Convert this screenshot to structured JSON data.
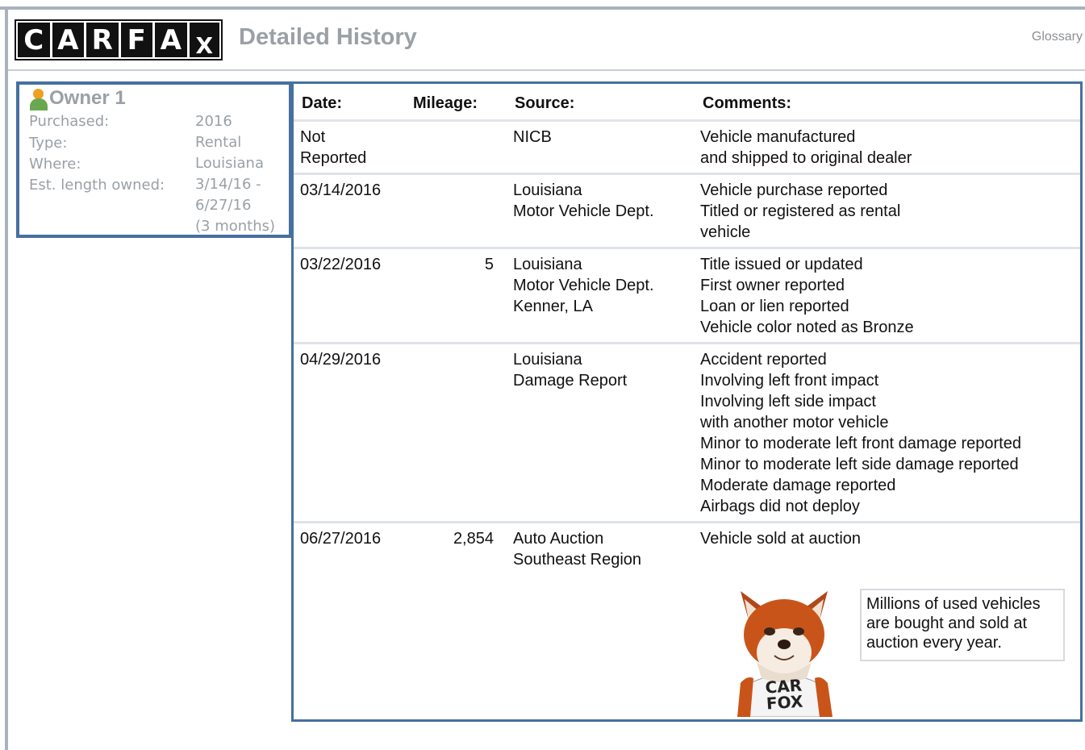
{
  "header": {
    "logo_letters": [
      "C",
      "A",
      "R",
      "F",
      "A",
      "X"
    ],
    "title": "Detailed History",
    "glossary_link": "Glossary"
  },
  "owner": {
    "title": "Owner 1",
    "rows": [
      {
        "label": "Purchased:",
        "value": "2016"
      },
      {
        "label": "Type:",
        "value": "Rental"
      },
      {
        "label": "Where:",
        "value": "Louisiana"
      },
      {
        "label": "Est. length owned:",
        "value": "3/14/16 -\n6/27/16\n(3 months)"
      }
    ]
  },
  "table": {
    "columns": [
      "Date:",
      "Mileage:",
      "Source:",
      "Comments:"
    ],
    "rows": [
      {
        "date": "Not\nReported",
        "mileage": "",
        "source": "NICB",
        "comments": "Vehicle manufactured\nand shipped to original dealer"
      },
      {
        "date": "03/14/2016",
        "mileage": "",
        "source": "Louisiana\nMotor Vehicle Dept.",
        "comments": "Vehicle purchase reported\nTitled or registered as rental\nvehicle"
      },
      {
        "date": "03/22/2016",
        "mileage": "5",
        "source": "Louisiana\nMotor Vehicle Dept.\nKenner, LA",
        "comments": "Title issued or updated\nFirst owner reported\nLoan or lien reported\nVehicle color noted as Bronze"
      },
      {
        "date": "04/29/2016",
        "mileage": "",
        "source": "Louisiana\nDamage Report",
        "comments": "Accident reported\nInvolving left front impact\nInvolving left side impact\nwith another motor vehicle\nMinor to moderate left front damage reported\nMinor to moderate left side damage reported\nModerate damage reported\nAirbags did not deploy"
      },
      {
        "date": "06/27/2016",
        "mileage": "2,854",
        "source": "Auto Auction\nSoutheast Region",
        "comments": "Vehicle sold at auction"
      }
    ]
  },
  "tip": {
    "text": "Millions of used vehicles are bought and sold at auction every year.",
    "mascot_shirt": "CAR\nFOX"
  },
  "colors": {
    "border_blue": "#46709f",
    "muted_gray": "#9aa0a6",
    "rule_gray": "#a9b2bd"
  }
}
